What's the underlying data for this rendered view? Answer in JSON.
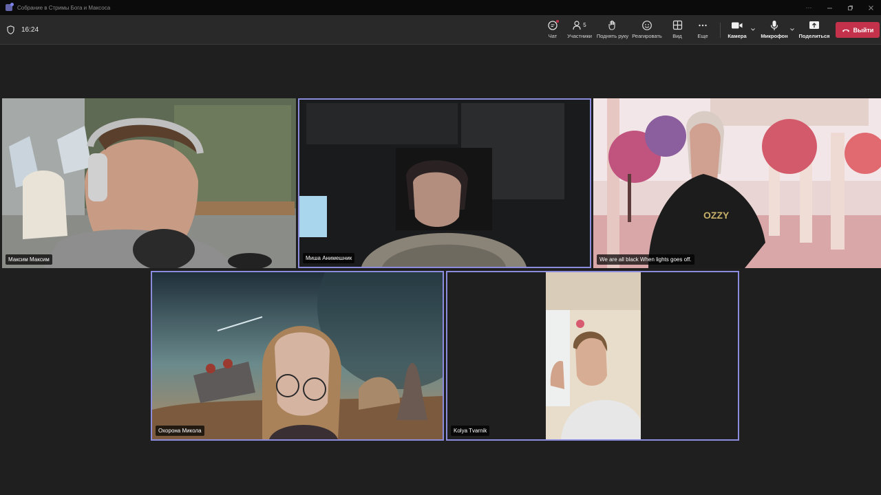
{
  "window": {
    "title": "Собрание в Стримы Бога и Максоса",
    "controls": [
      "more-icon",
      "minimize-icon",
      "restore-icon",
      "close-icon"
    ]
  },
  "toolbar": {
    "timer": "16:24",
    "chat_label": "Чат",
    "participants_label": "Участники",
    "participants_count": "5",
    "raise_hand_label": "Поднять руку",
    "react_label": "Реагировать",
    "view_label": "Вид",
    "more_label": "Еще",
    "camera_label": "Камера",
    "mic_label": "Микрофон",
    "share_label": "Поделиться",
    "leave_label": "Выйти"
  },
  "colors": {
    "leave_button": "#c4314b",
    "active_speaker_border": "#8b8cde",
    "background": "#1f1f1f"
  },
  "participants": [
    {
      "name": "Максим Максим"
    },
    {
      "name": "Миша Анимешник"
    },
    {
      "name": "We are all black When lights goes off."
    },
    {
      "name": "Охорона Микола"
    },
    {
      "name": "Kolya Tvarnik"
    }
  ]
}
